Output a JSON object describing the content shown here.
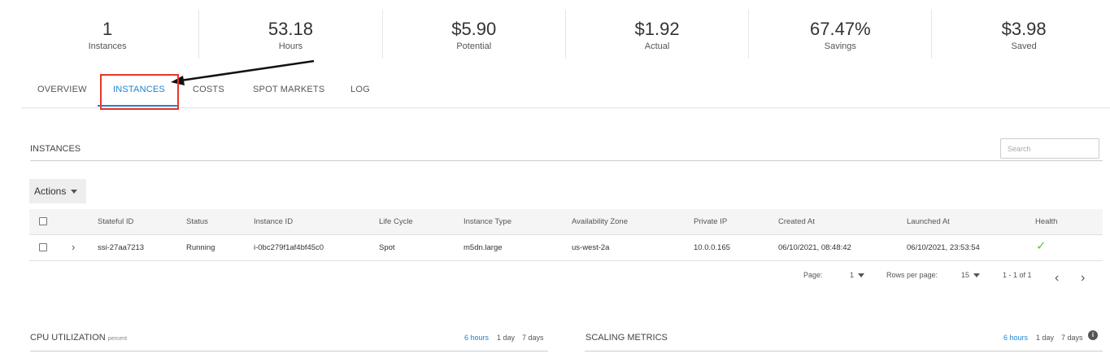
{
  "stats": [
    {
      "value": "1",
      "label": "Instances"
    },
    {
      "value": "53.18",
      "label": "Hours"
    },
    {
      "value": "$5.90",
      "label": "Potential"
    },
    {
      "value": "$1.92",
      "label": "Actual"
    },
    {
      "value": "67.47%",
      "label": "Savings"
    },
    {
      "value": "$3.98",
      "label": "Saved"
    }
  ],
  "tabs": [
    "OVERVIEW",
    "INSTANCES",
    "COSTS",
    "SPOT MARKETS",
    "LOG"
  ],
  "active_tab": "INSTANCES",
  "instances": {
    "title": "INSTANCES",
    "search_placeholder": "Search",
    "actions_label": "Actions",
    "columns": [
      "Stateful ID",
      "Status",
      "Instance ID",
      "Life Cycle",
      "Instance Type",
      "Availability Zone",
      "Private IP",
      "Created At",
      "Launched At",
      "Health"
    ],
    "rows": [
      {
        "stateful_id": "ssi-27aa7213",
        "status": "Running",
        "instance_id": "i-0bc279f1af4bf45c0",
        "life_cycle": "Spot",
        "instance_type": "m5dn.large",
        "availability_zone": "us-west-2a",
        "private_ip": "10.0.0.165",
        "created_at": "06/10/2021, 08:48:42",
        "launched_at": "06/10/2021, 23:53:54",
        "health_icon": "check-icon"
      }
    ],
    "pagination": {
      "page_label": "Page:",
      "page": "1",
      "rows_label": "Rows per page:",
      "rows_per_page": "15",
      "range": "1 - 1 of 1"
    }
  },
  "cpu": {
    "title": "CPU UTILIZATION",
    "unit": "percent",
    "ranges": [
      "6 hours",
      "1 day",
      "7 days"
    ]
  },
  "scaling": {
    "title": "SCALING METRICS",
    "ranges": [
      "6 hours",
      "1 day",
      "7 days"
    ]
  },
  "colors": {
    "accent": "#1d84d2",
    "highlight": "#e8352a",
    "health_ok": "#6cc04a"
  }
}
